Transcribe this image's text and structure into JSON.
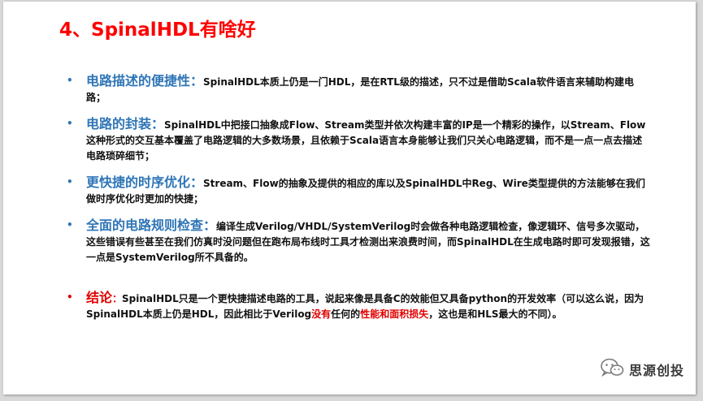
{
  "slide": {
    "title": "4、SpinalHDL有啥好",
    "bullets": [
      {
        "bullet": "•",
        "heading": "电路描述的便捷性：",
        "text": "SpinalHDL本质上仍是一门HDL，是在RTL级的描述，只不过是借助Scala软件语言来辅助构建电路；"
      },
      {
        "bullet": "•",
        "heading": "电路的封装：",
        "text": "SpinalHDL中把接口抽象成Flow、Stream类型并依次构建丰富的IP是一个精彩的操作，以Stream、Flow这种形式的交互基本覆盖了电路逻辑的大多数场景，且依赖于Scala语言本身能够让我们只关心电路逻辑，而不是一点一点去描述电路琐碎细节；"
      },
      {
        "bullet": "•",
        "heading": "更快捷的时序优化：",
        "text": "Stream、Flow的抽象及提供的相应的库以及SpinalHDL中Reg、Wire类型提供的方法能够在我们做时序优化时更加的快捷；"
      },
      {
        "bullet": "•",
        "heading": "全面的电路规则检查：",
        "text": "编译生成Verilog/VHDL/SystemVerilog时会做各种电路逻辑检查，像逻辑环、信号多次驱动，这些错误有些甚至在我们仿真时没问题但在跑布局布线时工具才检测出来浪费时间，而SpinalHDL在生成电路时即可发现报错，这一点是SystemVerilog所不具备的。"
      }
    ],
    "conclusion": {
      "bullet": "•",
      "heading": "结论",
      "colon": "：",
      "text_before": "SpinalHDL只是一个更快捷描述电路的工具，说起来像是具备C的效能但又具备python的开发效率（可以这么说，因为SpinalHDL本质上仍是HDL，因此相比于Verilog",
      "highlight1": "没有",
      "text_middle": "任何的",
      "highlight2": "性能和面积损失",
      "text_after": "，这也是和HLS最大的不同）。"
    }
  },
  "watermark": {
    "name": "思源创投",
    "icon": "wechat-icon"
  },
  "colors": {
    "title": "#ff0000",
    "heading": "#2e75b6",
    "conclusion": "#e00000",
    "background": "#d9d9d9",
    "slide": "#ffffff"
  }
}
